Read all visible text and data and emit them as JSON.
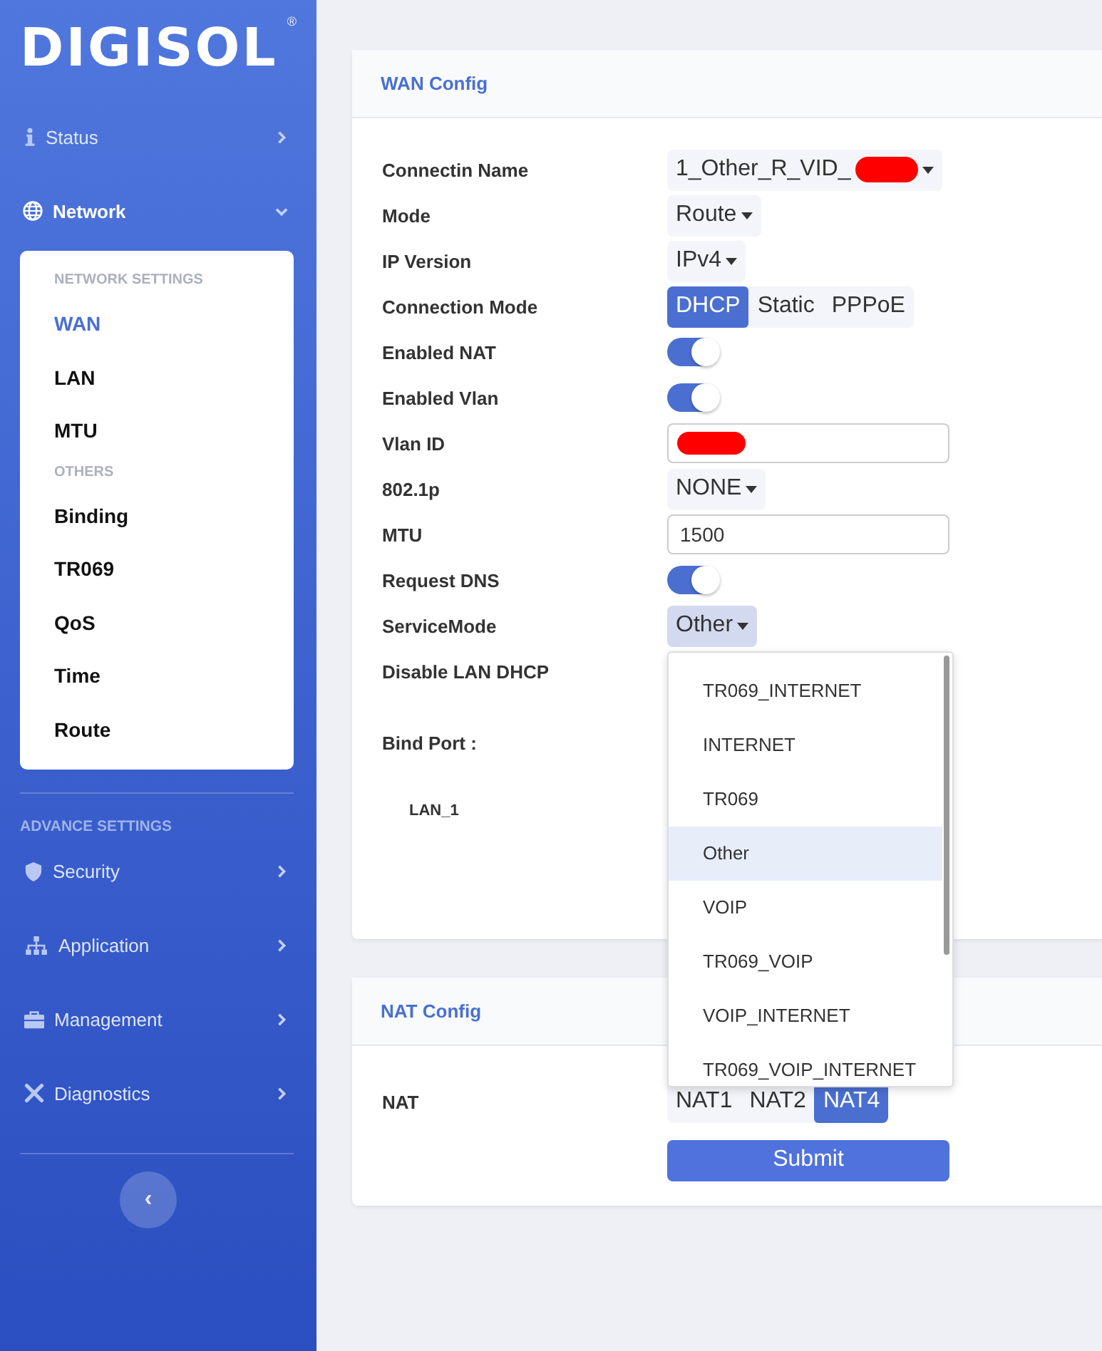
{
  "sidebar": {
    "logo": "DIGISOL",
    "logo_mark": "®",
    "items": [
      {
        "label": "Status",
        "expanded": false
      },
      {
        "label": "Network",
        "expanded": true,
        "submenu": [
          {
            "kind": "heading",
            "label": "NETWORK SETTINGS"
          },
          {
            "kind": "link",
            "label": "WAN",
            "selected": true
          },
          {
            "kind": "link",
            "label": "LAN",
            "selected": false
          },
          {
            "kind": "link",
            "label": "MTU",
            "selected": false
          },
          {
            "kind": "heading",
            "label": "OTHERS"
          },
          {
            "kind": "link",
            "label": "Binding",
            "selected": false
          },
          {
            "kind": "link",
            "label": "TR069",
            "selected": false
          },
          {
            "kind": "link",
            "label": "QoS",
            "selected": false
          },
          {
            "kind": "link",
            "label": "Time",
            "selected": false
          },
          {
            "kind": "link",
            "label": "Route",
            "selected": false
          }
        ]
      }
    ],
    "section_label": "ADVANCE SETTINGS",
    "advance_items": [
      {
        "label": "Security",
        "expanded": false
      },
      {
        "label": "Application",
        "expanded": false
      },
      {
        "label": "Management",
        "expanded": false
      },
      {
        "label": "Diagnostics",
        "expanded": false
      }
    ],
    "collapse_button": "‹"
  },
  "wan_config": {
    "title": "WAN Config",
    "fields": [
      {
        "kind": "select",
        "label": "Connectin Name",
        "value": "1_Other_R_VID_",
        "redacted": true
      },
      {
        "kind": "select",
        "label": "Mode",
        "value": "Route"
      },
      {
        "kind": "select",
        "label": "IP Version",
        "value": "IPv4"
      },
      {
        "kind": "segmented",
        "label": "Connection Mode",
        "options": [
          {
            "label": "DHCP",
            "selected": true
          },
          {
            "label": "Static",
            "selected": false
          },
          {
            "label": "PPPoE",
            "selected": false
          }
        ]
      },
      {
        "kind": "toggle",
        "label": "Enabled NAT",
        "on": true
      },
      {
        "kind": "toggle",
        "label": "Enabled Vlan",
        "on": true
      },
      {
        "kind": "input",
        "label": "Vlan ID",
        "redacted": true
      },
      {
        "kind": "select",
        "label": "802.1p",
        "value": "NONE"
      },
      {
        "kind": "input",
        "label": "MTU",
        "value": "1500"
      },
      {
        "kind": "toggle",
        "label": "Request DNS",
        "on": true
      },
      {
        "kind": "select",
        "label": "ServiceMode",
        "value": "Other",
        "open": true,
        "options": [
          {
            "label": "TR069_INTERNET",
            "selected": false
          },
          {
            "label": "INTERNET",
            "selected": false
          },
          {
            "label": "TR069",
            "selected": false
          },
          {
            "label": "Other",
            "selected": true
          },
          {
            "label": "VOIP",
            "selected": false
          },
          {
            "label": "TR069_VOIP",
            "selected": false
          },
          {
            "label": "VOIP_INTERNET",
            "selected": false
          },
          {
            "label": "TR069_VOIP_INTERNET",
            "selected": false
          }
        ]
      },
      {
        "kind": "covered",
        "label": "Disable LAN DHCP"
      }
    ],
    "bind_port": {
      "label": "Bind Port :",
      "ports": [
        "LAN_1"
      ]
    }
  },
  "nat_config": {
    "title": "NAT Config",
    "label": "NAT",
    "options": [
      {
        "label": "NAT1",
        "selected": false
      },
      {
        "label": "NAT2",
        "selected": false
      },
      {
        "label": "NAT4",
        "selected": true
      }
    ],
    "submit": "Submit"
  }
}
